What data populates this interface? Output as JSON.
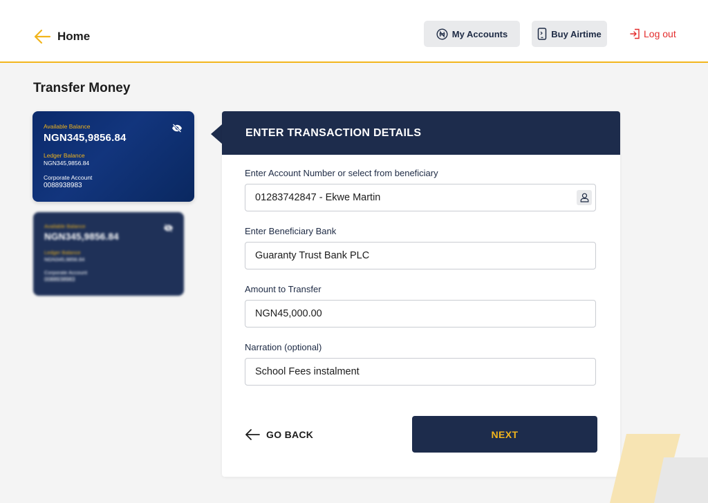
{
  "header": {
    "home_label": "Home",
    "my_accounts_label": "My Accounts",
    "buy_airtime_label": "Buy Airtime",
    "logout_label": "Log out"
  },
  "page_title": "Transfer Money",
  "cards": [
    {
      "available_label": "Available Balance",
      "available_value": "NGN345,9856.84",
      "ledger_label": "Ledger Balance",
      "ledger_value": "NGN345,9856.84",
      "account_type": "Corporate Account",
      "account_number": "0088938983"
    },
    {
      "available_label": "Available Balance",
      "available_value": "NGN345,9856.84",
      "ledger_label": "Ledger Balance",
      "ledger_value": "NGN345,9856.84",
      "account_type": "Corporate Account",
      "account_number": "0088938983"
    }
  ],
  "form": {
    "heading": "ENTER TRANSACTION DETAILS",
    "fields": [
      {
        "label": "Enter Account Number or select from beneficiary",
        "value": "01283742847 - Ekwe Martin"
      },
      {
        "label": "Enter Beneficiary Bank",
        "value": "Guaranty Trust Bank PLC"
      },
      {
        "label": "Amount to Transfer",
        "value": "NGN45,000.00"
      },
      {
        "label": "Narration (optional)",
        "value": "School Fees instalment"
      }
    ],
    "go_back_label": "GO BACK",
    "next_label": "NEXT"
  },
  "colors": {
    "accent_yellow": "#f2b51c",
    "navy": "#1d2c4c",
    "card_blue": "#12357d",
    "logout_red": "#e32b2b"
  },
  "icons": [
    "back-arrow-icon",
    "naira-icon",
    "phone-icon",
    "logout-icon",
    "eye-off-icon",
    "user-icon"
  ]
}
